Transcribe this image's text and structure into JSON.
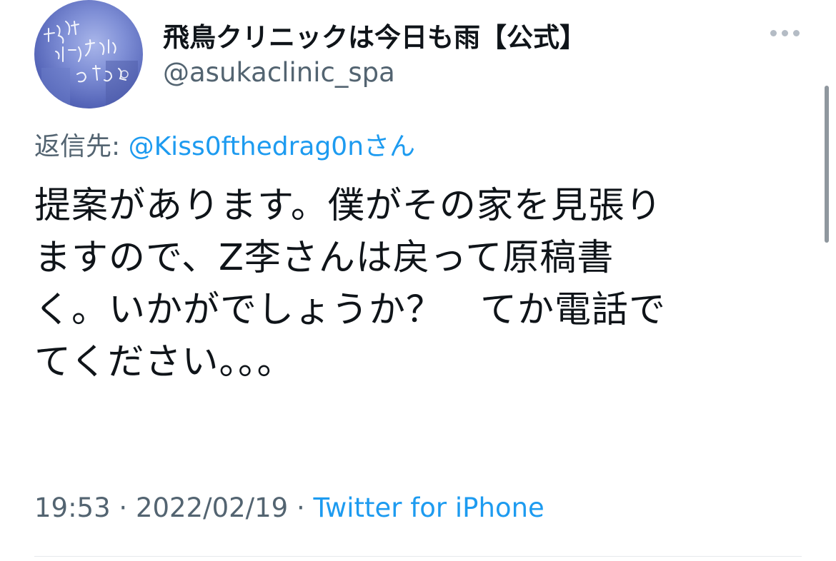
{
  "tweet": {
    "display_name": "飛鳥クリニックは今日も雨【公式】",
    "handle": "@asukaclinic_spa",
    "more_icon": "more-horizontal-icon",
    "reply_prefix": "返信先: ",
    "reply_mention": "@Kiss0fthedrag0nさん",
    "text_lines": [
      "提案があります。僕がその家を見張り",
      "ますので、Z李さんは戻って原稿書",
      "く。いかがでしょうか？　てか電話で",
      "てください。。。"
    ],
    "time": "19:53",
    "date": "2022/02/19",
    "separator": " · ",
    "source": "Twitter for iPhone"
  },
  "avatar": {
    "lettering": "飛鳥クリニックは今日も雨"
  },
  "colors": {
    "link": "#1d9bf0",
    "secondary": "#536471",
    "text": "#0f1419"
  }
}
